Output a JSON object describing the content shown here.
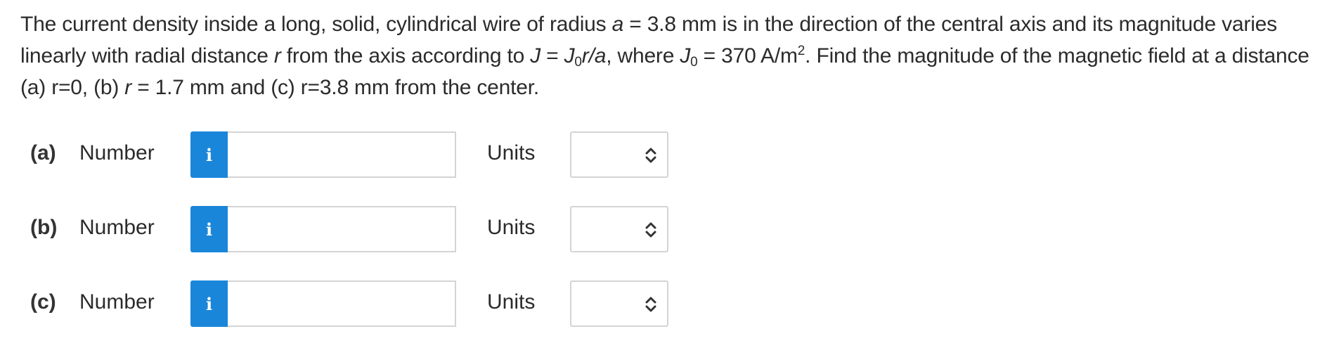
{
  "question": {
    "p1": "The current density inside a long, solid, cylindrical wire of radius ",
    "a_var": "a",
    "p2": " = 3.8 mm is in the direction of the central axis and its magnitude varies linearly with radial distance ",
    "r_var": "r",
    "p3": " from the axis according to ",
    "J_var": "J",
    "p4": " = ",
    "J0_var": "J",
    "J0_sub": "0",
    "r_over_a": "r/a",
    "p5": ", where ",
    "J0b_var": "J",
    "J0b_sub": "0",
    "p6": " = 370 A/m",
    "m_sup": "2",
    "p7": ". Find the magnitude of the magnetic field at a distance (a) r=0, (b) ",
    "r_var2": "r",
    "p8": " = 1.7 mm and (c) r=3.8 mm from the center."
  },
  "parts": [
    {
      "label": "(a)",
      "number_label": "Number",
      "info_icon": "i",
      "number_value": "",
      "units_label": "Units",
      "units_value": ""
    },
    {
      "label": "(b)",
      "number_label": "Number",
      "info_icon": "i",
      "number_value": "",
      "units_label": "Units",
      "units_value": ""
    },
    {
      "label": "(c)",
      "number_label": "Number",
      "info_icon": "i",
      "number_value": "",
      "units_label": "Units",
      "units_value": ""
    }
  ],
  "icons": {
    "info": "info-icon",
    "select": "chevron-updown-icon"
  },
  "colors": {
    "info_button": "#1a86d9",
    "text": "#2b2b2b",
    "border": "#d4d4d4"
  }
}
